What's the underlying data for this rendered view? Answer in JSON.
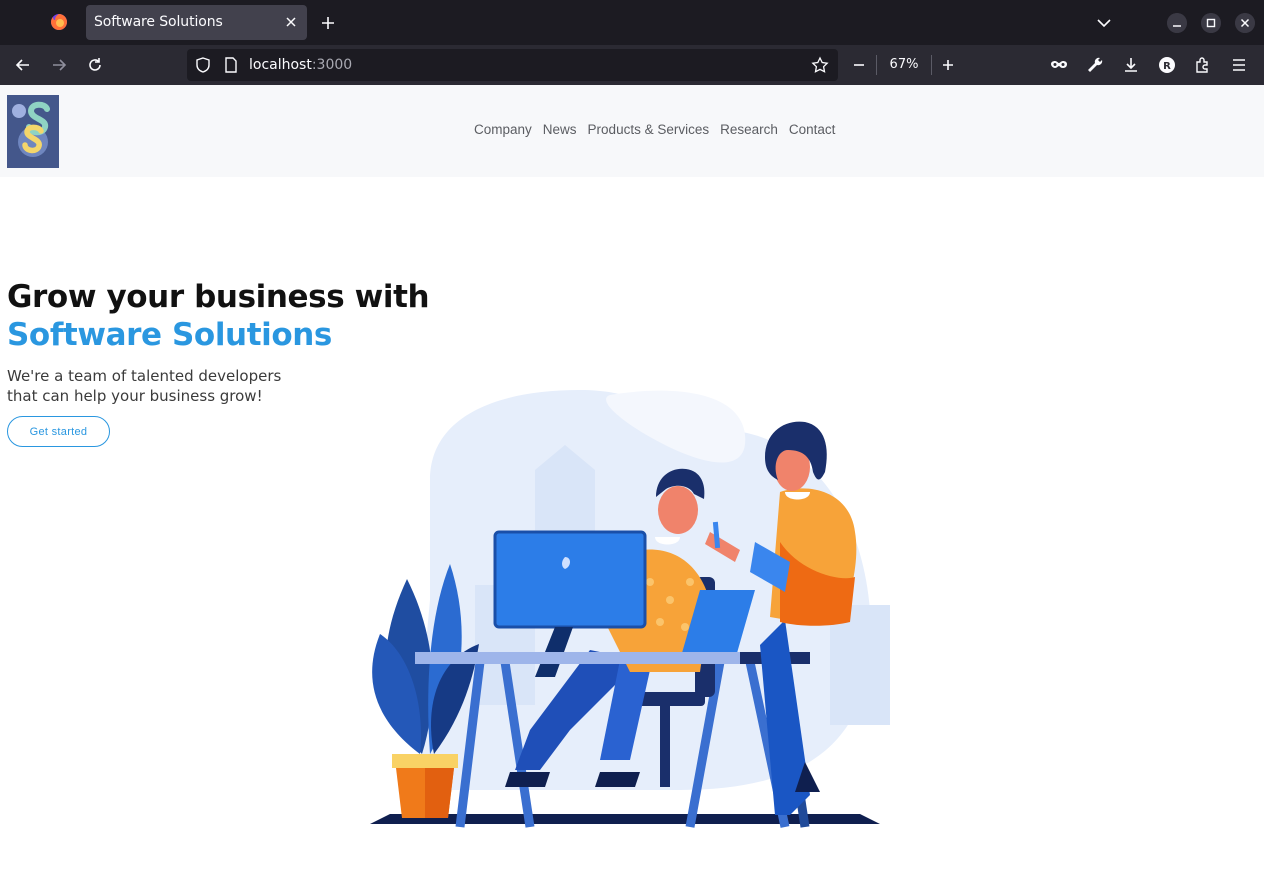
{
  "browser": {
    "tab_title": "Software Solutions",
    "url_host": "localhost",
    "url_port": ":3000",
    "zoom": "67%"
  },
  "site": {
    "nav": [
      "Company",
      "News",
      "Products & Services",
      "Research",
      "Contact"
    ],
    "hero": {
      "title_prefix": "Grow your business with ",
      "title_accent": "Software Solutions",
      "subtitle": "We're a team of talented developers that can help your business grow!",
      "cta_label": "Get started"
    }
  },
  "colors": {
    "accent": "#2a97e0",
    "chrome_dark": "#1c1b22",
    "toolbar": "#2b2a33",
    "header_bg": "#f7f8fa"
  }
}
